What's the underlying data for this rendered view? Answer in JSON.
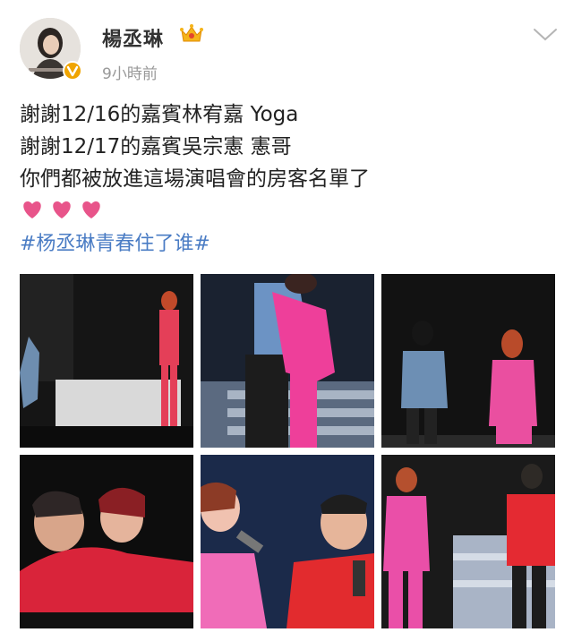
{
  "post": {
    "username": "楊丞琳",
    "timestamp": "9小時前",
    "lines": [
      "謝謝12/16的嘉賓林宥嘉 Yoga",
      "謝謝12/17的嘉賓吳宗憲 憲哥",
      "你們都被放進這場演唱會的房客名單了"
    ],
    "hearts_count": 3,
    "hashtag": "#杨丞琳青春住了谁#"
  },
  "icons": {
    "avatar": "profile-avatar",
    "verified": "verified-badge-icon",
    "crown": "vip-crown-icon",
    "menu": "chevron-down-icon",
    "heart": "heart-icon"
  },
  "colors": {
    "hashtag": "#4a7cc4",
    "heart": "#e8548a",
    "timestamp": "#999999",
    "verified": "#f0a400"
  },
  "photos": [
    {
      "id": 1
    },
    {
      "id": 2
    },
    {
      "id": 3
    },
    {
      "id": 4
    },
    {
      "id": 5
    },
    {
      "id": 6
    }
  ]
}
